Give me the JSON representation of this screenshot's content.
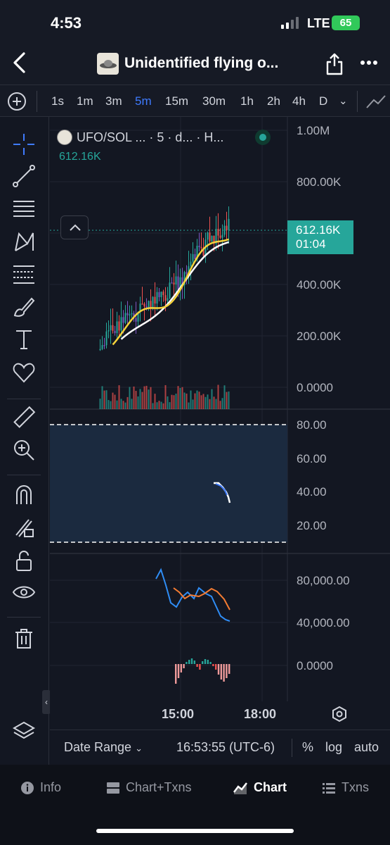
{
  "status_bar": {
    "time": "4:53",
    "network": "LTE",
    "battery": "65"
  },
  "header": {
    "title": "Unidentified flying o..."
  },
  "timeframes": [
    "1s",
    "1m",
    "3m",
    "5m",
    "15m",
    "30m",
    "1h",
    "2h",
    "4h",
    "D"
  ],
  "active_timeframe": "5m",
  "legend": {
    "text": "UFO/SOL ... · 5 · d... · H...",
    "price": "612.16K"
  },
  "price_axis": [
    "1.00M",
    "800.00K",
    "400.00K",
    "200.00K",
    "0.0000"
  ],
  "last_price": {
    "value": "612.16K",
    "countdown": "01:04"
  },
  "rsi_axis": [
    "80.00",
    "60.00",
    "40.00",
    "20.00"
  ],
  "osc_axis": [
    "80,000.00",
    "40,000.00",
    "0.0000"
  ],
  "time_axis": [
    "15:00",
    "18:00"
  ],
  "footer": {
    "date_range": "Date Range",
    "time": "16:53:55 (UTC-6)",
    "percent": "%",
    "log": "log",
    "auto": "auto"
  },
  "nav": [
    {
      "label": "Info",
      "icon": "info-icon"
    },
    {
      "label": "Chart+Txns",
      "icon": "split-view-icon"
    },
    {
      "label": "Chart",
      "icon": "chart-icon"
    },
    {
      "label": "Txns",
      "icon": "list-icon"
    }
  ],
  "active_nav": "Chart",
  "colors": {
    "up": "#26a69a",
    "down": "#ef5350",
    "accent": "#3f7bff",
    "ma_fast": "#f5d33b",
    "ma_slow": "#ffffff",
    "wick_purple": "#7e57c2"
  }
}
